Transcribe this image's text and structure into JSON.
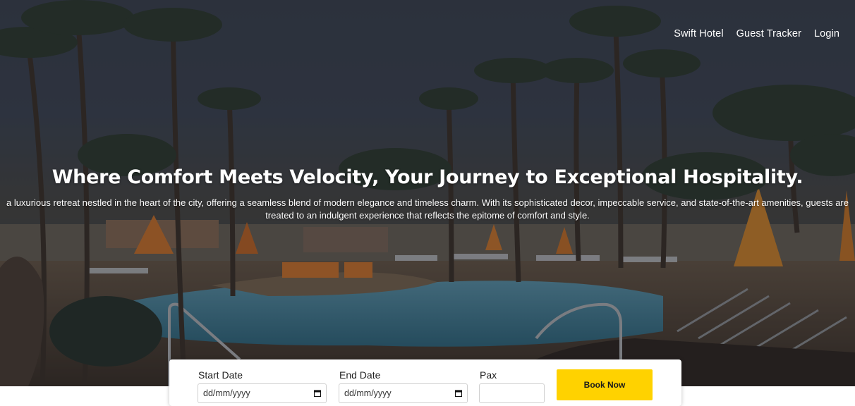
{
  "nav": {
    "items": [
      {
        "label": "Swift Hotel"
      },
      {
        "label": "Guest Tracker"
      },
      {
        "label": "Login"
      }
    ]
  },
  "hero": {
    "headline": "Where Comfort Meets Velocity, Your Journey to Exceptional Hospitality.",
    "description": "a luxurious retreat nestled in the heart of the city, offering a seamless blend of modern elegance and timeless charm. With its sophisticated decor, impeccable service, and state-of-the-art amenities, guests are treated to an indulgent experience that reflects the epitome of comfort and style."
  },
  "booking": {
    "start_label": "Start Date",
    "start_value": "dd/mm/yyyy",
    "end_label": "End Date",
    "end_value": "dd/mm/yyyy",
    "pax_label": "Pax",
    "pax_value": "",
    "button_label": "Book Now"
  },
  "colors": {
    "accent": "#ffd200",
    "overlay": "#1e2128",
    "pool_water": "#4f8fa8"
  },
  "icons": {
    "date_picker": "calendar-icon"
  }
}
